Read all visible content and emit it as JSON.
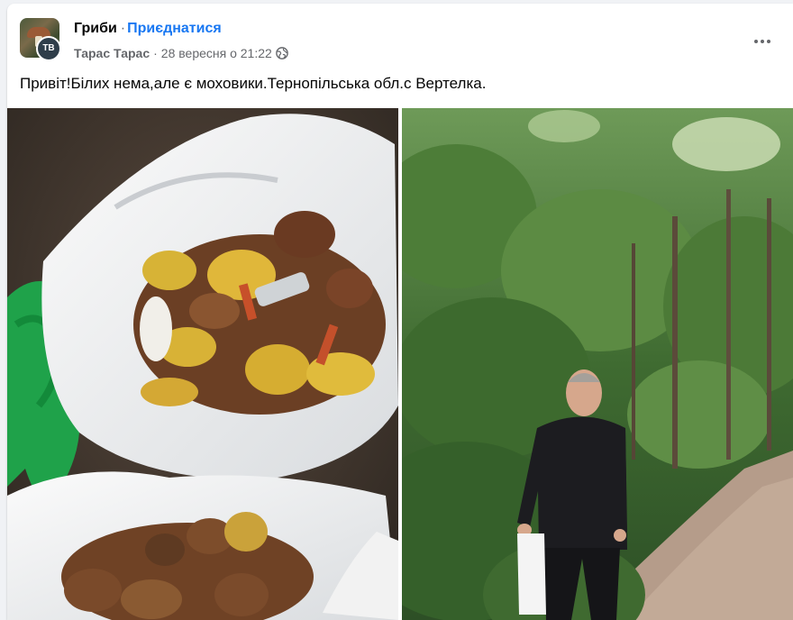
{
  "post": {
    "group_name": "Гриби",
    "separator": "·",
    "join_label": "Приєднатися",
    "author": "Тарас Тарас",
    "meta_separator": "·",
    "timestamp": "28 вересня о 21:22",
    "audience_icon": "globe-icon",
    "more_icon": "more-options-icon",
    "text": "Привіт!Білих нема,але є моховики.Тернопільська обл.с Вертелка.",
    "user_avatar_initials": "TB"
  },
  "photos": [
    {
      "name": "photo-mushrooms-in-bags"
    },
    {
      "name": "photo-man-in-forest"
    }
  ],
  "colors": {
    "link": "#1877f2",
    "text_primary": "#050505",
    "text_secondary": "#65676b"
  }
}
